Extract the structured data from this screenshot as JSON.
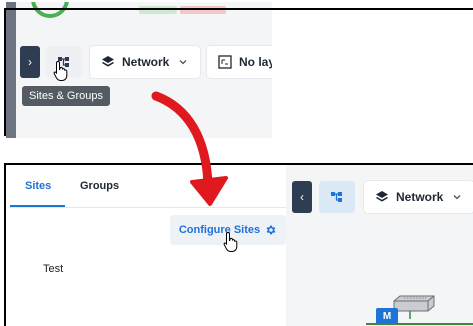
{
  "top_toolbar": {
    "tooltip": "Sites & Groups",
    "network_label": "Network",
    "layout_label": "No lay"
  },
  "sites_panel": {
    "tabs": [
      {
        "label": "Sites",
        "active": true
      },
      {
        "label": "Groups",
        "active": false
      }
    ],
    "configure_label": "Configure Sites",
    "sites": [
      "Test"
    ]
  },
  "map_toolbar": {
    "network_label": "Network"
  },
  "map": {
    "node_badge": "M"
  },
  "colors": {
    "accent": "#1e73d6",
    "arrow": "#e0191f",
    "sidebar_button": "#2f3d52"
  },
  "icons": [
    "chevron-right-icon",
    "sites-groups-icon",
    "layers-icon",
    "chevron-down-icon",
    "layout-icon",
    "gear-icon",
    "chevron-left-icon",
    "pointer-hand-icon",
    "switch-device-icon"
  ]
}
